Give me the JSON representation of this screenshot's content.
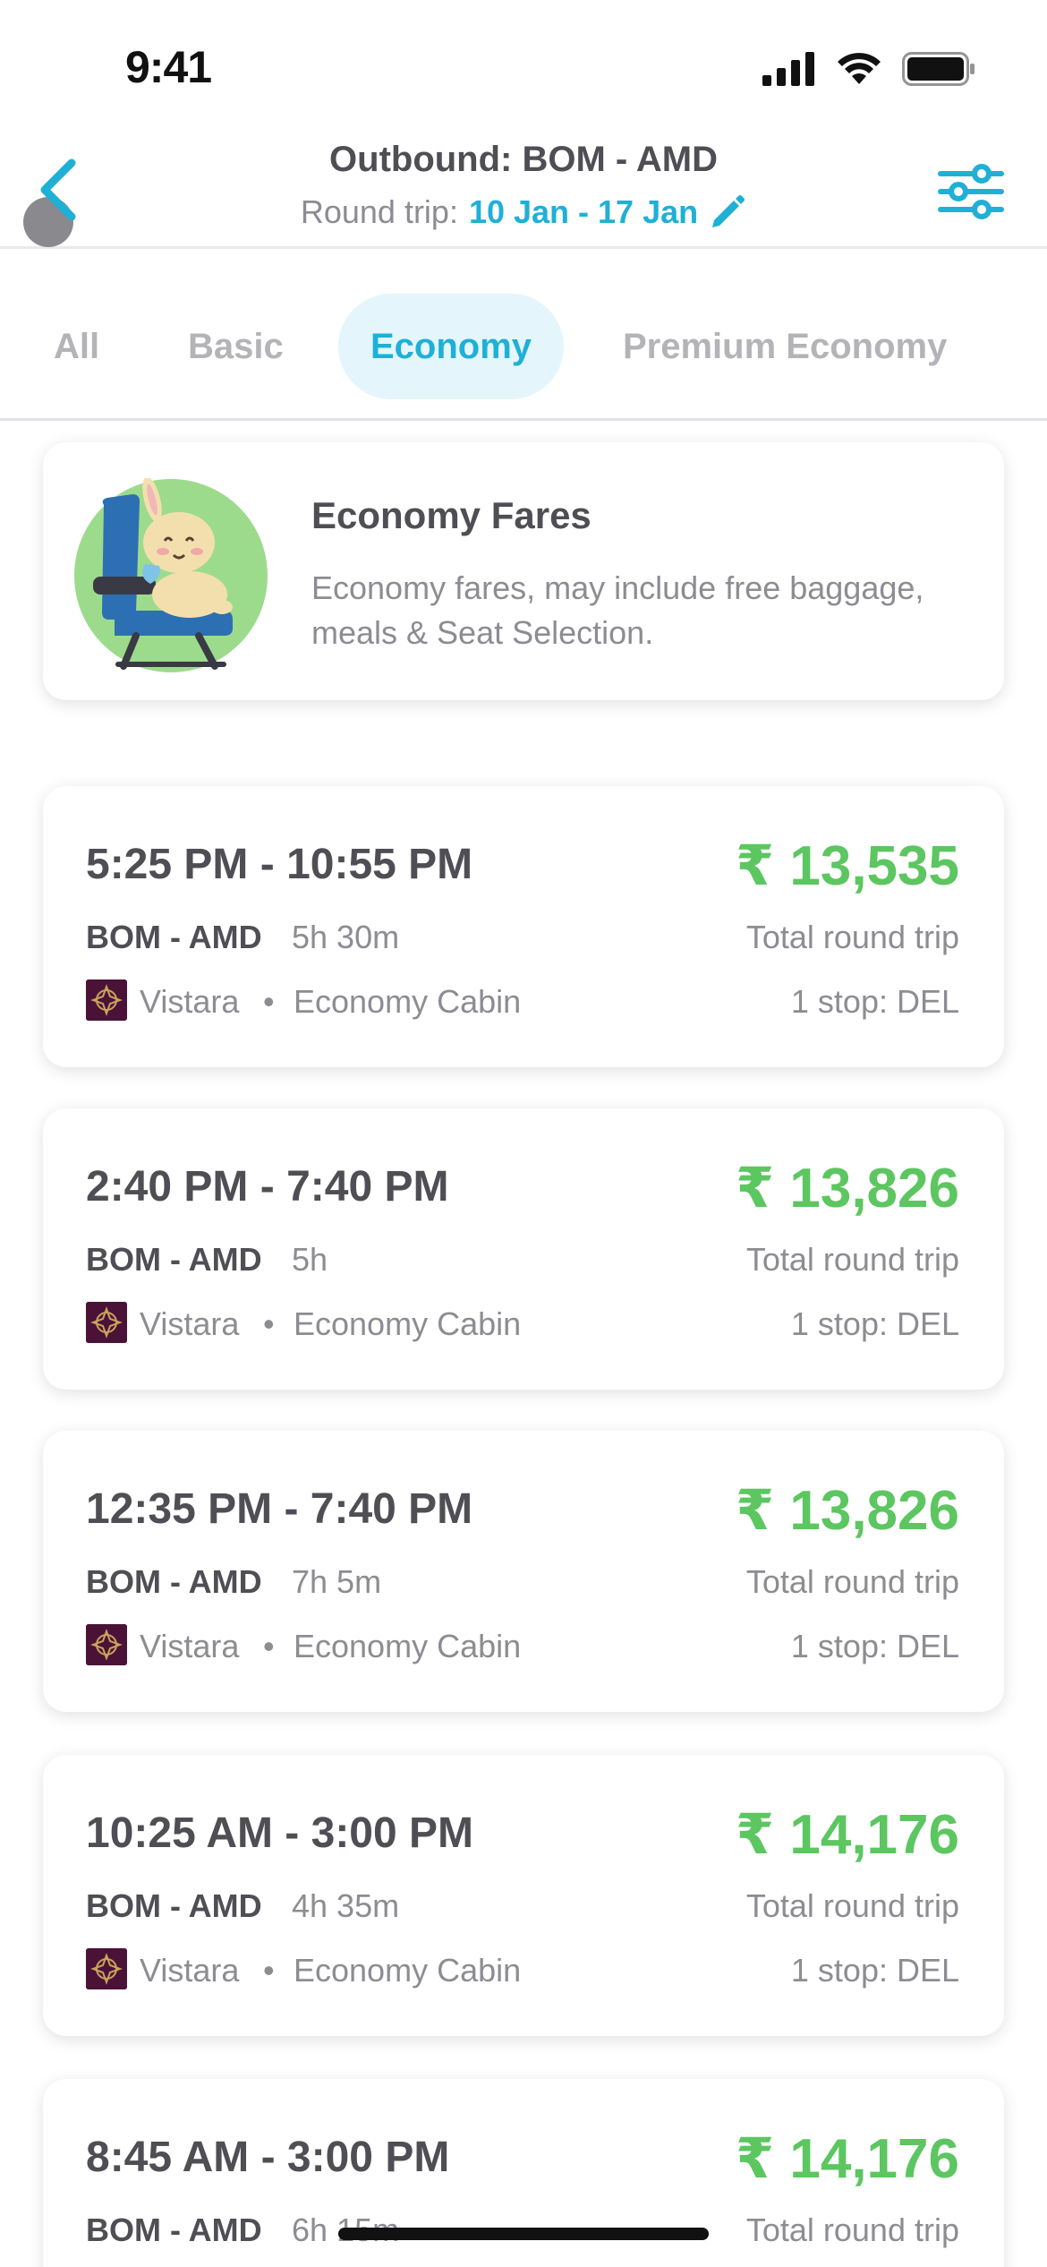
{
  "status_bar": {
    "time": "9:41"
  },
  "header": {
    "title": "Outbound: BOM - AMD",
    "trip_label": "Round trip:",
    "dates": "10 Jan - 17 Jan"
  },
  "tabs": [
    {
      "label": "All",
      "active": false
    },
    {
      "label": "Basic",
      "active": false
    },
    {
      "label": "Economy",
      "active": true
    },
    {
      "label": "Premium Economy",
      "active": false
    }
  ],
  "info_card": {
    "title": "Economy Fares",
    "description": "Economy fares, may include free baggage, meals & Seat Selection."
  },
  "flights": [
    {
      "time": "5:25 PM - 10:55 PM",
      "price": "₹ 13,535",
      "route": "BOM - AMD",
      "duration": "5h 30m",
      "price_note": "Total round trip",
      "airline": "Vistara",
      "separator": "•",
      "cabin": "Economy Cabin",
      "stops": "1 stop: DEL"
    },
    {
      "time": "2:40 PM - 7:40 PM",
      "price": "₹ 13,826",
      "route": "BOM - AMD",
      "duration": "5h",
      "price_note": "Total round trip",
      "airline": "Vistara",
      "separator": "•",
      "cabin": "Economy Cabin",
      "stops": "1 stop: DEL"
    },
    {
      "time": "12:35 PM - 7:40 PM",
      "price": "₹ 13,826",
      "route": "BOM - AMD",
      "duration": "7h 5m",
      "price_note": "Total round trip",
      "airline": "Vistara",
      "separator": "•",
      "cabin": "Economy Cabin",
      "stops": "1 stop: DEL"
    },
    {
      "time": "10:25 AM - 3:00 PM",
      "price": "₹ 14,176",
      "route": "BOM - AMD",
      "duration": "4h 35m",
      "price_note": "Total round trip",
      "airline": "Vistara",
      "separator": "•",
      "cabin": "Economy Cabin",
      "stops": "1 stop: DEL"
    },
    {
      "time": "8:45 AM - 3:00 PM",
      "price": "₹ 14,176",
      "route": "BOM - AMD",
      "duration": "6h 15m",
      "price_note": "Total round trip"
    }
  ],
  "colors": {
    "accent": "#1fb0d6",
    "price": "#5cc660",
    "airline_logo": "#4b1238"
  }
}
